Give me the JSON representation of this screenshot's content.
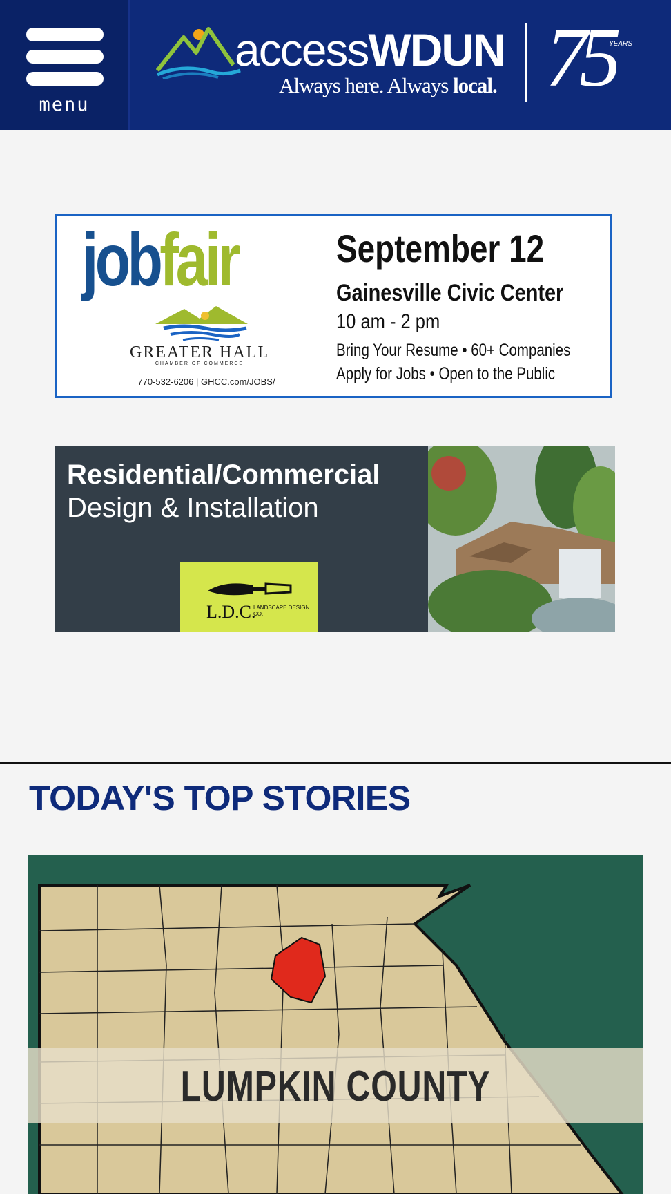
{
  "header": {
    "menu_label": "menu",
    "logo_access": "access",
    "logo_wdun": "WDUN",
    "tagline_prefix": "Always here. Always ",
    "tagline_bold": "local.",
    "anniversary_number": "75",
    "anniversary_years": "YEARS",
    "bg_color": "#0e2a7a"
  },
  "ads": {
    "jobfair": {
      "job": "job",
      "fair": "fair",
      "date": "September 12",
      "venue": "Gainesville Civic Center",
      "time": "10 am - 2 pm",
      "line1": "Bring Your Resume • 60+ Companies",
      "line2": "Apply for Jobs • Open to the Public",
      "chamber": "GREATER HALL",
      "chamber_sub": "CHAMBER OF COMMERCE",
      "contact": "770-532-6206  |  GHCC.com/JOBS/"
    },
    "landscape": {
      "headline": "Residential/Commercial",
      "subhead": "Design & Installation",
      "logo_text": "L.D.C.",
      "logo_sub": "LANDSCAPE DESIGN CO."
    }
  },
  "section": {
    "title": "TODAY'S TOP STORIES"
  },
  "story": {
    "image_label": "LUMPKIN COUNTY"
  }
}
